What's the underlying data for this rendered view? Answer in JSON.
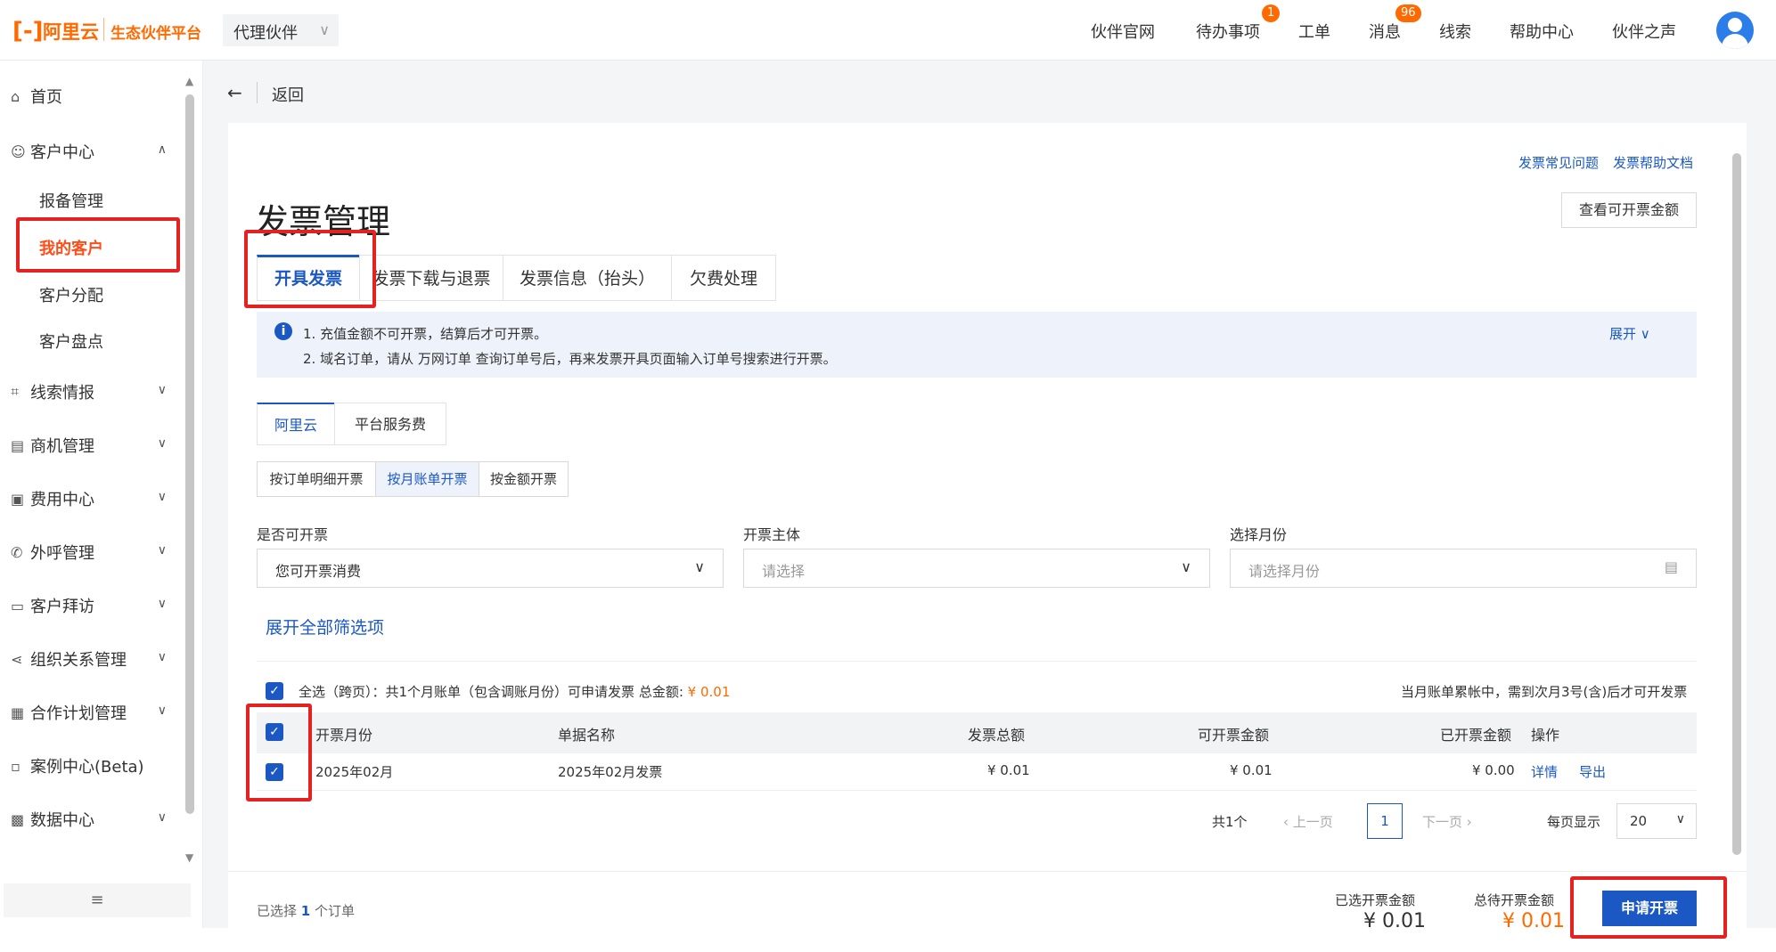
{
  "header": {
    "logo": "阿里云",
    "platform": "生态伙伴平台",
    "role_select": "代理伙伴",
    "nav": [
      {
        "label": "伙伴官网",
        "badge": ""
      },
      {
        "label": "待办事项",
        "badge": "1"
      },
      {
        "label": "工单",
        "badge": ""
      },
      {
        "label": "消息",
        "badge": "96"
      },
      {
        "label": "线索",
        "badge": ""
      },
      {
        "label": "帮助中心",
        "badge": ""
      },
      {
        "label": "伙伴之声",
        "badge": ""
      }
    ]
  },
  "sidebar": {
    "home": "首页",
    "customer_center": "客户中心",
    "sub_items": [
      "报备管理",
      "我的客户",
      "客户分配",
      "客户盘点"
    ],
    "groups": [
      "线索情报",
      "商机管理",
      "费用中心",
      "外呼管理",
      "客户拜访",
      "组织关系管理",
      "合作计划管理",
      "案例中心(Beta)",
      "数据中心"
    ]
  },
  "back": {
    "label": "返回"
  },
  "page": {
    "title": "发票管理",
    "faq_links": [
      "发票常见问题",
      "发票帮助文档"
    ],
    "view_amount_button": "查看可开票金额",
    "tabs": [
      "开具发票",
      "发票下载与退票",
      "发票信息（抬头）",
      "欠费处理"
    ],
    "notice_lines": [
      "1. 充值金额不可开票，结算后才可开票。",
      "2. 域名订单，请从 万网订单 查询订单号后，再来发票开具页面输入订单号搜索进行开票。"
    ],
    "notice_expand": "展开",
    "subtabs": [
      "阿里云",
      "平台服务费"
    ],
    "mode_buttons": [
      "按订单明细开票",
      "按月账单开票",
      "按金额开票"
    ],
    "filters": [
      {
        "label": "是否可开票",
        "value": "您可开票消费"
      },
      {
        "label": "开票主体",
        "value": "请选择"
      },
      {
        "label": "选择月份",
        "value": "请选择月份"
      }
    ],
    "expand_all": "展开全部筛选项",
    "select_all_text": "全选（跨页）：共1个月账单（包含调账月份）可申请发票   总金额:",
    "select_all_amount": "¥ 0.01",
    "bill_note": "当月账单累帐中，需到次月3号(含)后才可开发票",
    "table_headers": [
      "开票月份",
      "单据名称",
      "发票总额",
      "可开票金额",
      "已开票金额",
      "操作"
    ],
    "table_rows": [
      {
        "month": "2025年02月",
        "name": "2025年02月发票",
        "total": "¥ 0.01",
        "available": "¥ 0.01",
        "issued": "¥ 0.00",
        "detail": "详情",
        "export": "导出"
      }
    ],
    "pagination": {
      "total": "共1个",
      "prev": "上一页",
      "page": "1",
      "next": "下一页",
      "per_page_label": "每页显示",
      "per_page": "20"
    },
    "footer": {
      "selected_prefix": "已选择",
      "selected_count": "1",
      "selected_suffix": "个订单",
      "selected_amount_label": "已选开票金额",
      "selected_amount": "¥ 0.01",
      "pending_amount_label": "总待开票金额",
      "pending_amount": "¥ 0.01",
      "apply_button": "申请开票"
    }
  },
  "colors": {
    "brand": "#ff6a00",
    "primary": "#1b58c4",
    "highlight": "#e52222"
  }
}
